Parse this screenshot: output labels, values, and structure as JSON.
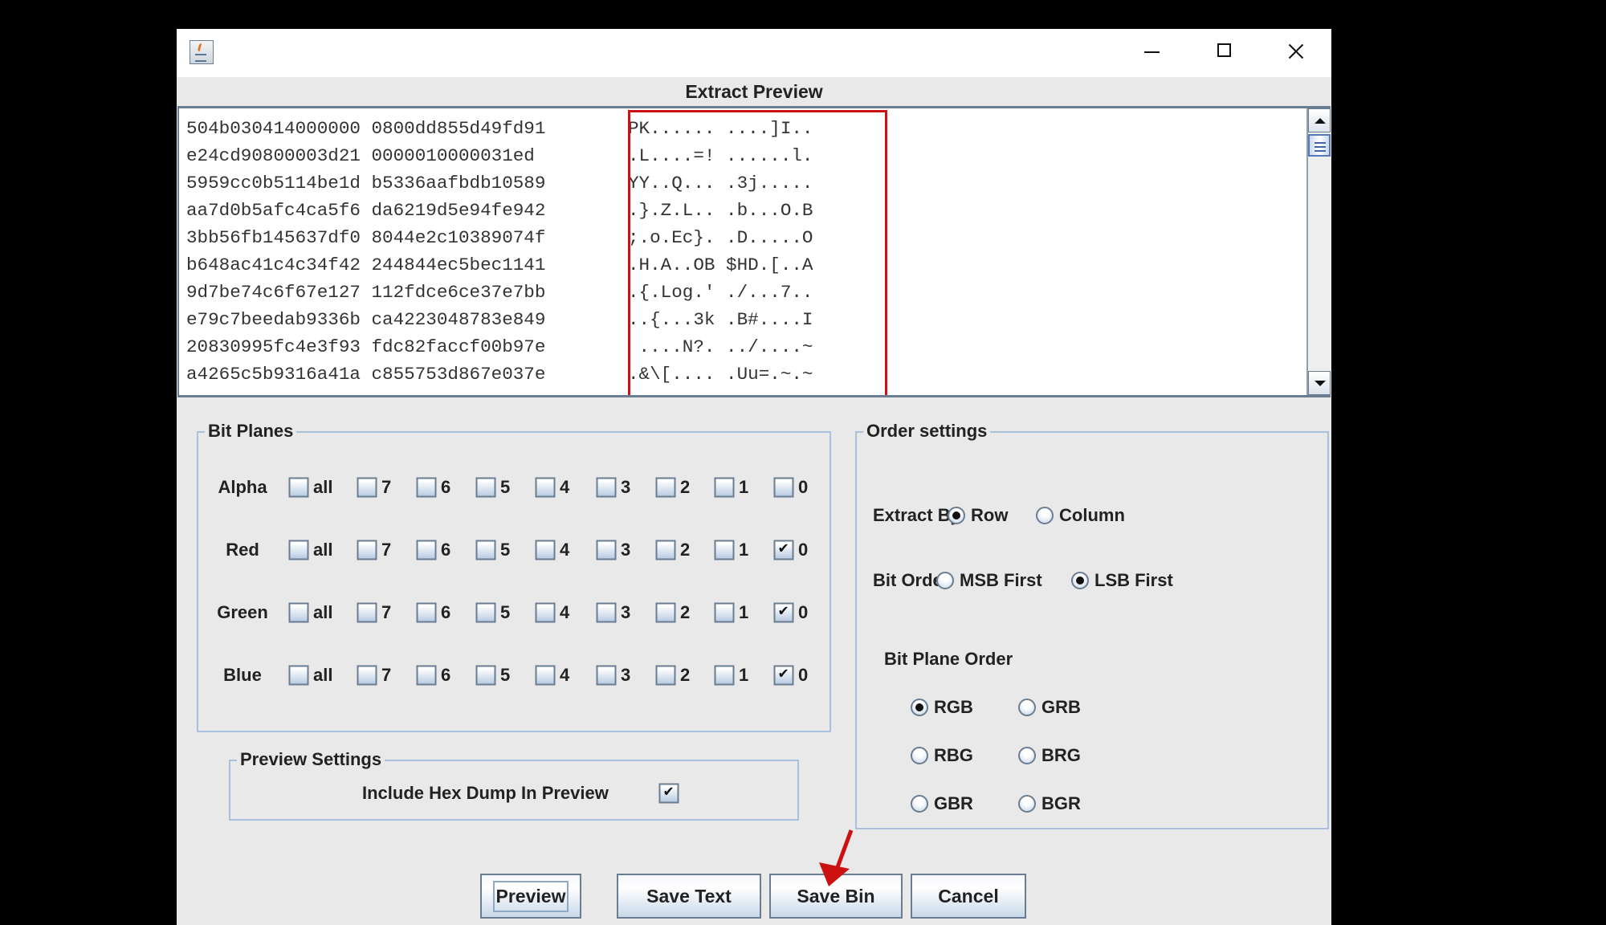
{
  "window": {
    "title": "",
    "controls": {
      "minimize": "minimize-icon",
      "maximize": "maximize-icon",
      "close": "close-icon"
    }
  },
  "preview": {
    "header": "Extract Preview",
    "lines": [
      {
        "hex": "504b030414000000 0800dd855d49fd91",
        "ascii": "PK...... ....]I.."
      },
      {
        "hex": "e24cd90800003d21 0000010000031ed",
        "ascii": ".L....=! ......l."
      },
      {
        "hex": "5959cc0b5114be1d b5336aafbdb10589",
        "ascii": "YY..Q... .3j....."
      },
      {
        "hex": "aa7d0b5afc4ca5f6 da6219d5e94fe942",
        "ascii": ".}.Z.L.. .b...O.B"
      },
      {
        "hex": "3bb56fb145637df0 8044e2c10389074f",
        "ascii": ";.o.Ec}. .D.....O"
      },
      {
        "hex": "b648ac41c4c34f42 244844ec5bec1141",
        "ascii": ".H.A..OB $HD.[..A"
      },
      {
        "hex": "9d7be74c6f67e127 112fdce6ce37e7bb",
        "ascii": ".{.Log.' ./...7.."
      },
      {
        "hex": "e79c7beedab9336b ca4223048783e849",
        "ascii": "..{...3k .B#....I"
      },
      {
        "hex": "20830995fc4e3f93 fdc82faccf00b97e",
        "ascii": " ....N?. ../....~"
      },
      {
        "hex": "a4265c5b9316a41a c855753d867e037e",
        "ascii": ".&\\[.... .Uu=.~.~"
      }
    ],
    "highlight_color": "#cc1111"
  },
  "bit_planes": {
    "title": "Bit Planes",
    "bits": [
      "all",
      "7",
      "6",
      "5",
      "4",
      "3",
      "2",
      "1",
      "0"
    ],
    "channels": [
      {
        "label": "Alpha",
        "checked": []
      },
      {
        "label": "Red",
        "checked": [
          "0"
        ]
      },
      {
        "label": "Green",
        "checked": [
          "0"
        ]
      },
      {
        "label": "Blue",
        "checked": [
          "0"
        ]
      }
    ]
  },
  "order_settings": {
    "title": "Order settings",
    "extract_by": {
      "label": "Extract By",
      "options": [
        "Row",
        "Column"
      ],
      "selected": "Row"
    },
    "bit_order": {
      "label": "Bit Order",
      "options": [
        "MSB First",
        "LSB First"
      ],
      "selected": "LSB First"
    },
    "bit_plane_order": {
      "label": "Bit Plane Order",
      "options": [
        "RGB",
        "GRB",
        "RBG",
        "BRG",
        "GBR",
        "BGR"
      ],
      "selected": "RGB"
    }
  },
  "preview_settings": {
    "title": "Preview Settings",
    "include_hex_label": "Include Hex Dump In Preview",
    "include_hex_checked": true
  },
  "buttons": {
    "preview": "Preview",
    "save_text": "Save Text",
    "save_bin": "Save Bin",
    "cancel": "Cancel"
  },
  "annotation": {
    "arrow_color": "#cc1111",
    "points_to": "Save Bin"
  }
}
